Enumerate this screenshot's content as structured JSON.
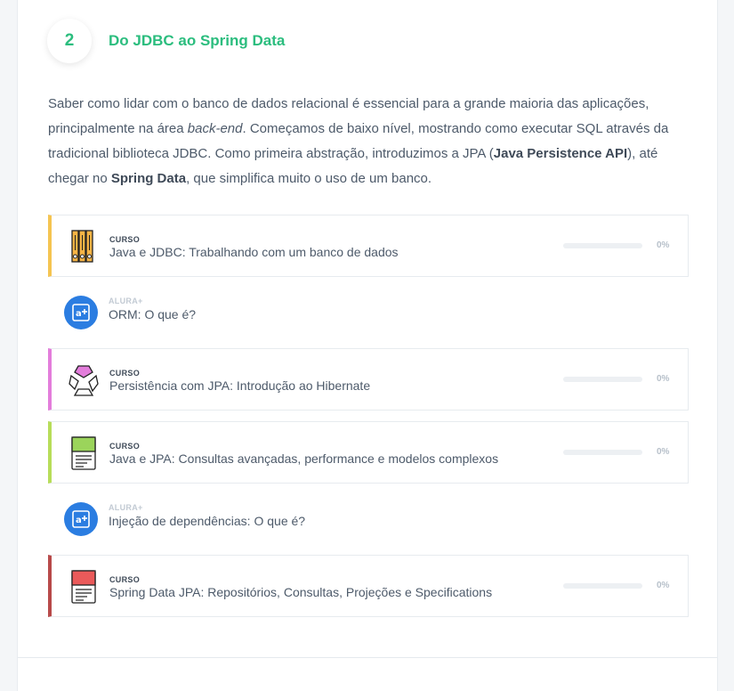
{
  "section": {
    "number": "2",
    "title": "Do JDBC ao Spring Data"
  },
  "intro": {
    "t1": "Saber como lidar com o banco de dados relacional é essencial para a grande maioria das aplicações, principalmente na área ",
    "t2": "back-end",
    "t3": ". Começamos de baixo nível, mostrando como executar SQL através da tradicional biblioteca JDBC. Como primeira abstração, introduzimos a JPA (",
    "t4": "Java Persistence API",
    "t5": "), até chegar no ",
    "t6": "Spring Data",
    "t7": ", que simplifica muito o uso de um banco."
  },
  "items": [
    {
      "type": "course",
      "kind": "CURSO",
      "title": "Java e JDBC: Trabalhando com um banco de dados",
      "progress_pct": 0,
      "progress_label": "0%",
      "accent": "#f5c451",
      "icon": "books-icon"
    },
    {
      "type": "alura_plus",
      "kind": "ALURA+",
      "title": "ORM: O que é?",
      "accent": "#2b7de1",
      "icon": "alura-plus-icon"
    },
    {
      "type": "course",
      "kind": "CURSO",
      "title": "Persistência com JPA: Introdução ao Hibernate",
      "progress_pct": 0,
      "progress_label": "0%",
      "accent": "#e37ddb",
      "icon": "hibernate-icon"
    },
    {
      "type": "course",
      "kind": "CURSO",
      "title": "Java e JPA: Consultas avançadas, performance e modelos complexos",
      "progress_pct": 0,
      "progress_label": "0%",
      "accent": "#b7dd59",
      "icon": "green-document-icon"
    },
    {
      "type": "alura_plus",
      "kind": "ALURA+",
      "title": "Injeção de dependências: O que é?",
      "accent": "#2b7de1",
      "icon": "alura-plus-icon"
    },
    {
      "type": "course",
      "kind": "CURSO",
      "title": "Spring Data JPA: Repositórios, Consultas, Projeções e Specifications",
      "progress_pct": 0,
      "progress_label": "0%",
      "accent": "#b84a4a",
      "icon": "red-document-icon"
    }
  ],
  "colors": {
    "section_green": "#2bbd7e",
    "alura_plus_blue": "#2b7de1"
  }
}
